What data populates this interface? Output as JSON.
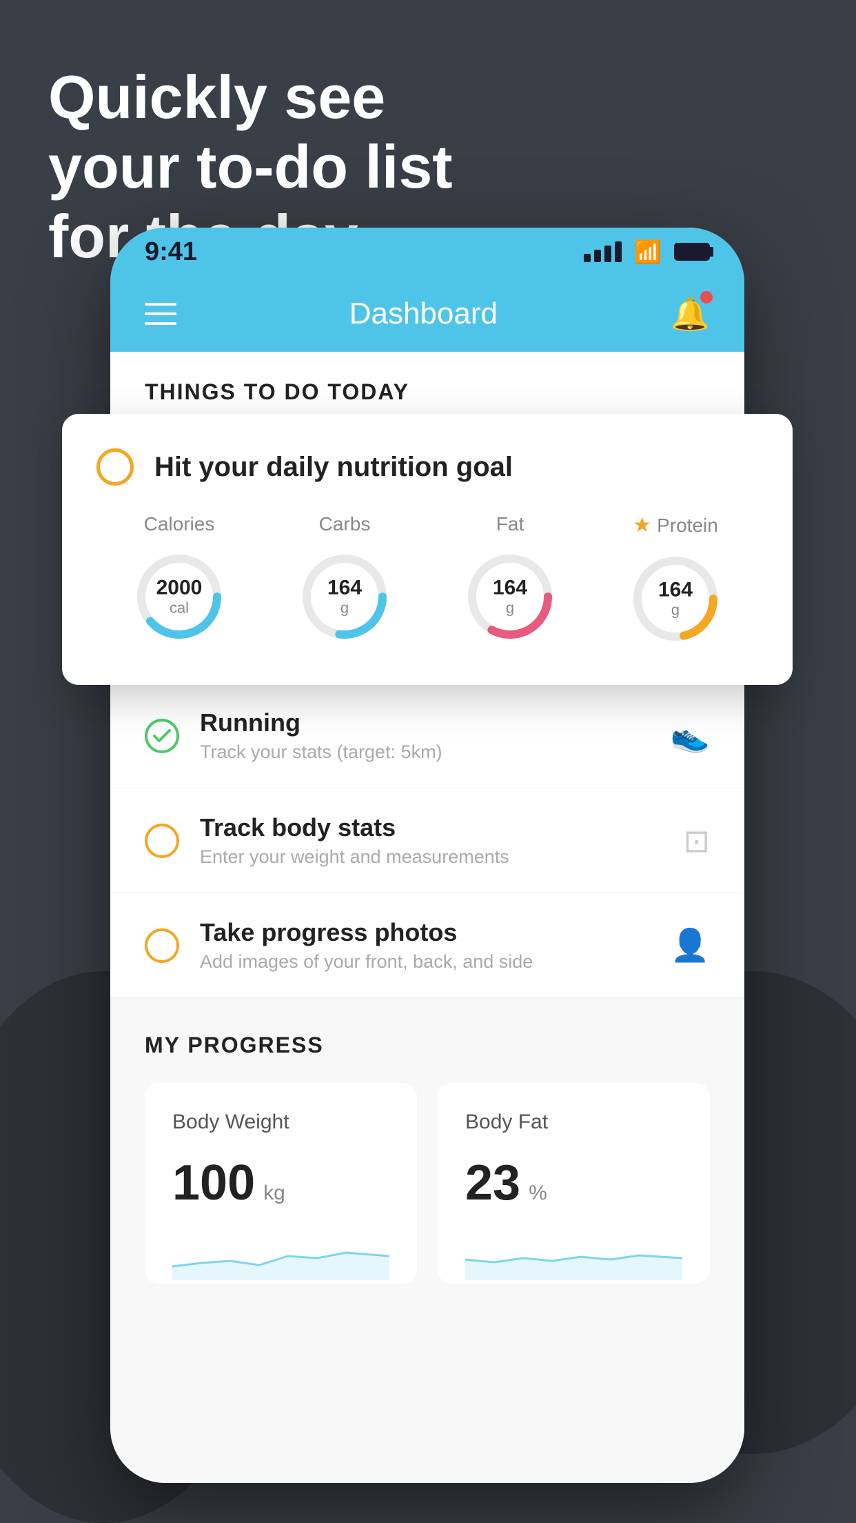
{
  "background": {
    "color": "#3a3f47"
  },
  "headline": {
    "line1": "Quickly see",
    "line2": "your to-do list",
    "line3": "for the day."
  },
  "status_bar": {
    "time": "9:41",
    "color": "#4ec5e8"
  },
  "header": {
    "title": "Dashboard",
    "color": "#4ec5e8"
  },
  "things_section": {
    "label": "THINGS TO DO TODAY"
  },
  "nutrition_card": {
    "title": "Hit your daily nutrition goal",
    "metrics": [
      {
        "label": "Calories",
        "value": "2000",
        "unit": "cal",
        "color": "#4ec5e8",
        "starred": false
      },
      {
        "label": "Carbs",
        "value": "164",
        "unit": "g",
        "color": "#4ec5e8",
        "starred": false
      },
      {
        "label": "Fat",
        "value": "164",
        "unit": "g",
        "color": "#e85a7e",
        "starred": false
      },
      {
        "label": "Protein",
        "value": "164",
        "unit": "g",
        "color": "#f5a623",
        "starred": true
      }
    ]
  },
  "todo_items": [
    {
      "title": "Running",
      "subtitle": "Track your stats (target: 5km)",
      "circle_type": "green",
      "icon": "🏃"
    },
    {
      "title": "Track body stats",
      "subtitle": "Enter your weight and measurements",
      "circle_type": "yellow",
      "icon": "⚖"
    },
    {
      "title": "Take progress photos",
      "subtitle": "Add images of your front, back, and side",
      "circle_type": "yellow",
      "icon": "👤"
    }
  ],
  "progress_section": {
    "label": "MY PROGRESS",
    "cards": [
      {
        "title": "Body Weight",
        "value": "100",
        "unit": "kg"
      },
      {
        "title": "Body Fat",
        "value": "23",
        "unit": "%"
      }
    ]
  },
  "notification_dot_color": "#e84e4e"
}
